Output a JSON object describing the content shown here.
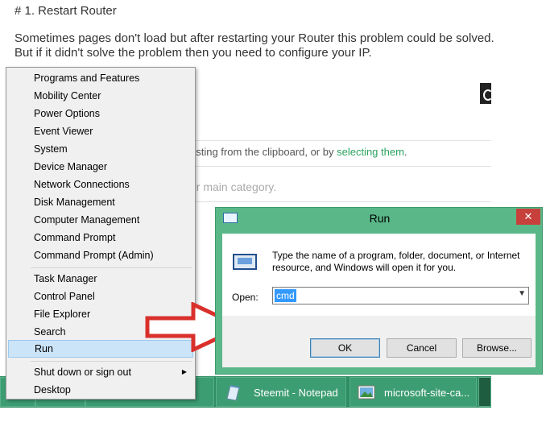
{
  "article": {
    "heading": "# 1. Restart Router",
    "para_line1": "Sometimes pages don't load but after restarting your Router this problem could be solved.",
    "para_line2": "But if it didn't solve the problem then you need to configure your IP.",
    "hint_prefix": "asting from the clipboard, or by ",
    "hint_link": "selecting them",
    "hint_suffix": ".",
    "category_placeholder": "ur main category."
  },
  "context_menu": {
    "items_group1": [
      "Programs and Features",
      "Mobility Center",
      "Power Options",
      "Event Viewer",
      "System",
      "Device Manager",
      "Network Connections",
      "Disk Management",
      "Computer Management",
      "Command Prompt",
      "Command Prompt (Admin)"
    ],
    "items_group2": [
      "Task Manager",
      "Control Panel",
      "File Explorer",
      "Search",
      "Run"
    ],
    "items_group3": [
      "Shut down or sign out",
      "Desktop"
    ],
    "highlighted": "Run"
  },
  "run_dialog": {
    "title": "Run",
    "close_symbol": "✕",
    "description": "Type the name of a program, folder, document, or Internet resource, and Windows will open it for you.",
    "open_label": "Open:",
    "open_value": "cmd",
    "ok_label": "OK",
    "cancel_label": "Cancel",
    "browse_label": "Browse..."
  },
  "taskbar": {
    "items": [
      {
        "label": "Steemit - Notepad",
        "icon": "notepad-icon"
      },
      {
        "label": "microsoft-site-ca...",
        "icon": "image-viewer-icon"
      }
    ]
  },
  "colors": {
    "accent_green": "#5ab888",
    "taskbar": "#2f8d63",
    "arrow_red": "#d9302c",
    "link_green": "#2aa25f"
  }
}
